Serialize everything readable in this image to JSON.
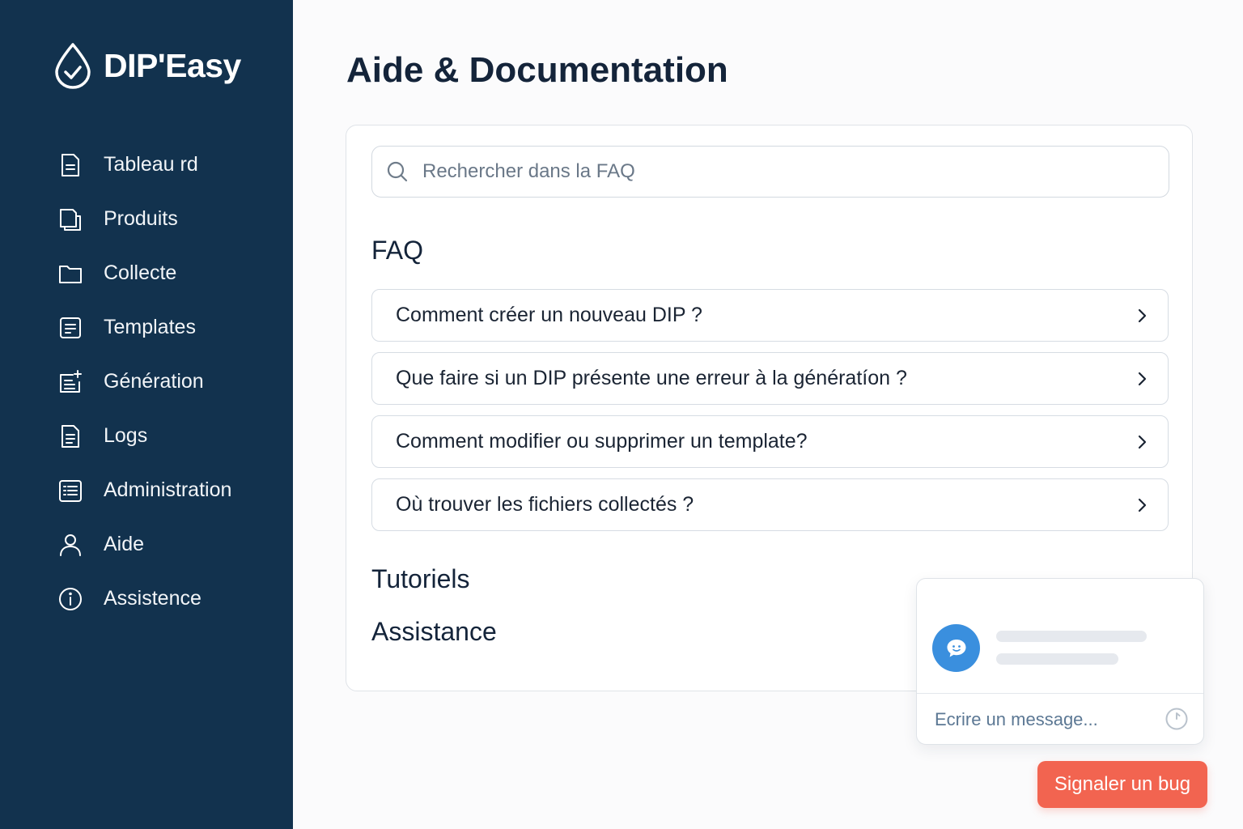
{
  "brand": {
    "name": "DIP'Easy",
    "icon": "drop-check-icon"
  },
  "sidebar": {
    "items": [
      {
        "label": "Tableau rd",
        "icon": "document-icon"
      },
      {
        "label": "Produits",
        "icon": "copy-documents-icon"
      },
      {
        "label": "Collecte",
        "icon": "folder-icon"
      },
      {
        "label": "Templates",
        "icon": "template-icon"
      },
      {
        "label": "Génération",
        "icon": "generate-icon"
      },
      {
        "label": "Logs",
        "icon": "log-file-icon"
      },
      {
        "label": "Administration",
        "icon": "list-icon"
      },
      {
        "label": "Aide",
        "icon": "user-icon"
      },
      {
        "label": "Assistence",
        "icon": "info-icon"
      }
    ]
  },
  "page": {
    "title": "Aide & Documentation"
  },
  "search": {
    "placeholder": "Rechercher dans la FAQ",
    "value": ""
  },
  "faq": {
    "title": "FAQ",
    "questions": [
      "Comment créer un nouveau DIP ?",
      "Que faire si un DIP présente une erreur à la génératíon ?",
      "Comment modifier ou supprimer un template?",
      "Où trouver les fichiers collectés ?"
    ]
  },
  "sections": {
    "tutorials": "Tutoriels",
    "assistance": "Assistance"
  },
  "chat": {
    "placeholder": "Ecrire un message...",
    "avatar_icon": "chat-bubble-icon",
    "send_icon": "send-icon"
  },
  "bug_button": {
    "label": "Signaler un bug"
  },
  "colors": {
    "sidebar": "#12324e",
    "accent": "#3a8fde",
    "bug": "#f26450",
    "text": "#14243a"
  }
}
